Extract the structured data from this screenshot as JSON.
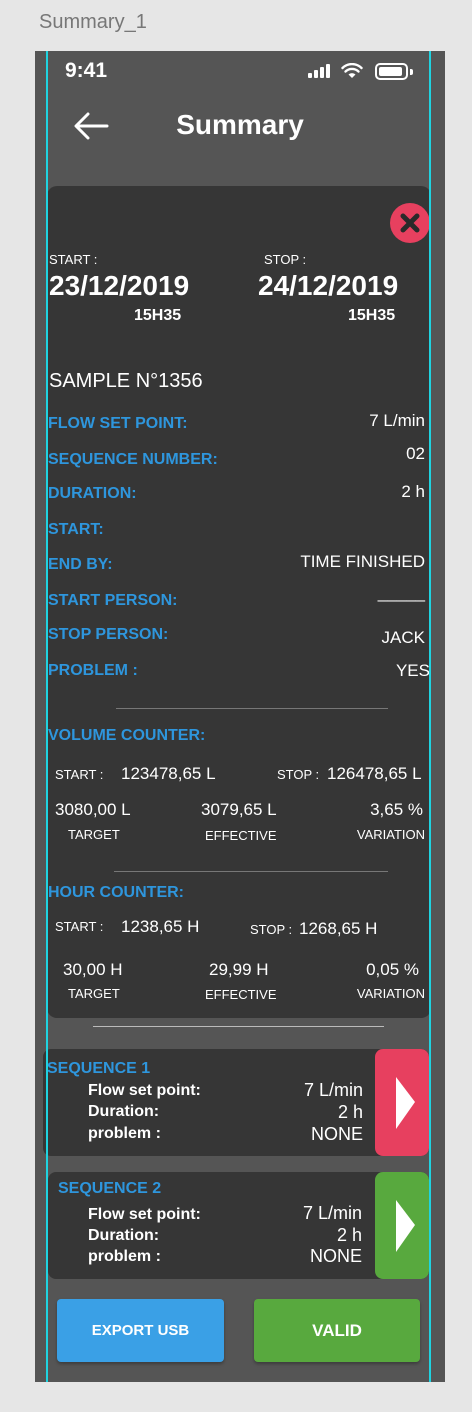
{
  "frame_label": "Summary_1",
  "status_bar": {
    "time": "9:41"
  },
  "header": {
    "title": "Summary"
  },
  "dates": {
    "start_label": "START :",
    "start_date": "23/12/2019",
    "start_hour": "15H35",
    "stop_label": "STOP :",
    "stop_date": "24/12/2019",
    "stop_hour": "15H35"
  },
  "sample": {
    "title": "SAMPLE N°1356",
    "fields": [
      {
        "label": "FLOW SET POINT:",
        "value": "7 L/min"
      },
      {
        "label": "SEQUENCE NUMBER:",
        "value": "02"
      },
      {
        "label": "DURATION:",
        "value": "2 h"
      },
      {
        "label": "START:",
        "value": ""
      },
      {
        "label": "END BY:",
        "value": "TIME FINISHED"
      },
      {
        "label": "START PERSON:",
        "value": "_____"
      },
      {
        "label": "STOP PERSON:",
        "value": "JACK"
      },
      {
        "label": "PROBLEM :",
        "value": "YES"
      }
    ]
  },
  "volume_counter": {
    "title": "VOLUME COUNTER:",
    "start_label": "START :",
    "start_value": "123478,65 L",
    "stop_label": "STOP :",
    "stop_value": "126478,65 L",
    "target_value": "3080,00 L",
    "target_label": "TARGET",
    "effective_value": "3079,65 L",
    "effective_label": "EFFECTIVE",
    "variation_value": "3,65 %",
    "variation_label": "VARIATION"
  },
  "hour_counter": {
    "title": "HOUR COUNTER:",
    "start_label": "START :",
    "start_value": "1238,65 H",
    "stop_label": "STOP :",
    "stop_value": "1268,65 H",
    "target_value": "30,00 H",
    "target_label": "TARGET",
    "effective_value": "29,99 H",
    "effective_label": "EFFECTIVE",
    "variation_value": "0,05 %",
    "variation_label": "VARIATION"
  },
  "sequences": [
    {
      "title": "SEQUENCE 1",
      "flow_label": "Flow set point:",
      "flow_value": "7 L/min",
      "duration_label": "Duration:",
      "duration_value": "2 h",
      "problem_label": "problem :",
      "problem_value": "NONE",
      "arrow_color": "#e7405f"
    },
    {
      "title": "SEQUENCE 2",
      "flow_label": "Flow set point:",
      "flow_value": "7 L/min",
      "duration_label": "Duration:",
      "duration_value": "2 h",
      "problem_label": "problem :",
      "problem_value": "NONE",
      "arrow_color": "#58a93e"
    }
  ],
  "buttons": {
    "export": "EXPORT USB",
    "valid": "VALID"
  },
  "colors": {
    "accent_blue": "#2e96dd",
    "danger_red": "#e7405f",
    "success_green": "#58a93e",
    "card_bg": "#363636",
    "screen_bg": "#555555",
    "guide_cyan": "#1fd3e0"
  }
}
